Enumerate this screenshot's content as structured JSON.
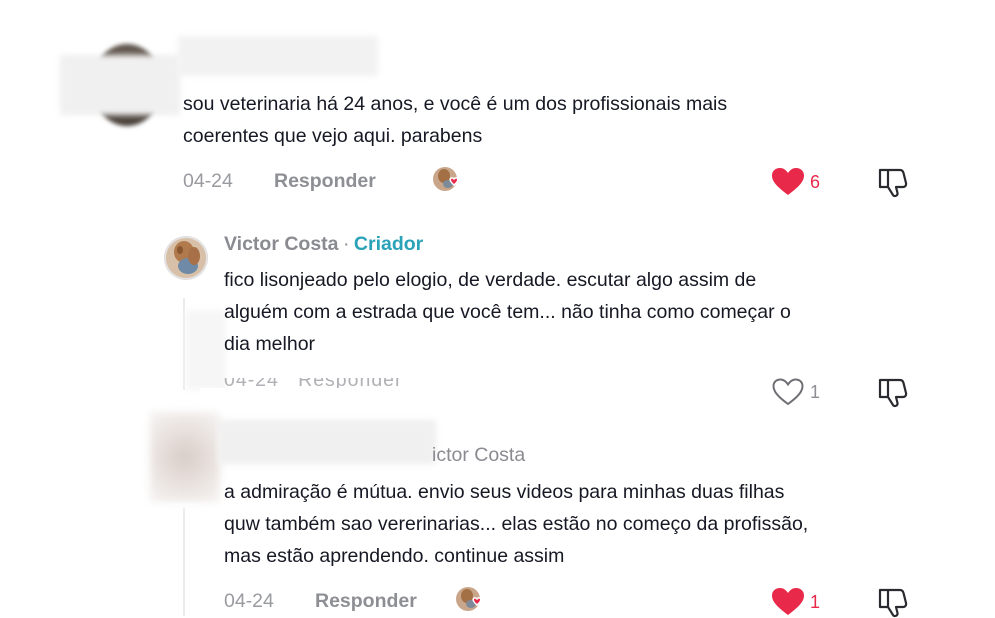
{
  "comments": [
    {
      "text_lines": [
        "sou veterinaria há 24 anos, e você é um dos profissionais mais",
        "coerentes que vejo aqui. parabens"
      ],
      "date": "04-24",
      "reply_label": "Responder",
      "like_count": "6",
      "liked": true
    },
    {
      "author": "Victor Costa",
      "separator": "·",
      "badge": "Criador",
      "text_lines": [
        "fico lisonjeado pelo elogio, de verdade. escutar algo assim de",
        "alguém com a estrada que você tem... não tinha como começar o",
        "dia melhor"
      ],
      "like_count": "1",
      "liked": false
    },
    {
      "author_partial": "ictor Costa",
      "text_lines": [
        "a admiração é mútua. envio seus videos para minhas duas filhas",
        "quw também sao vererinarias... elas estão no começo da profissão,",
        "mas estão aprendendo. continue assim"
      ],
      "date": "04-24",
      "reply_label": "Responder",
      "like_count": "1",
      "liked": true
    }
  ],
  "colors": {
    "like_red": "#e8294a",
    "creator_teal": "#2aa2b8",
    "muted": "#9a9ba0"
  },
  "icons": [
    "heart-filled-icon",
    "heart-outline-icon",
    "dislike-icon",
    "creator-liked-avatar-icon"
  ]
}
